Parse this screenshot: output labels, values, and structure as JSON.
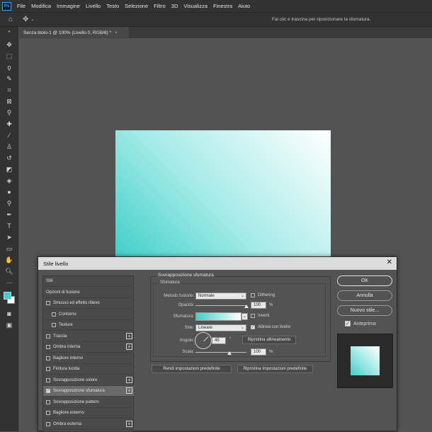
{
  "menubar": {
    "logo": "Ps",
    "items": [
      "File",
      "Modifica",
      "Immagine",
      "Livello",
      "Testo",
      "Selezione",
      "Filtro",
      "3D",
      "Visualizza",
      "Finestra",
      "Aiuto"
    ]
  },
  "optionsbar": {
    "hint": "Fai clic e trascina per riposizionare la sfumatura."
  },
  "document": {
    "tab_title": "Senza titolo-1 @ 100% (Livello 0, RGB/8) *",
    "close": "×"
  },
  "dialog": {
    "title": "Stile livello",
    "close": "✕",
    "styles": [
      {
        "label": "Stili",
        "checkbox": false,
        "plus": false,
        "indent": 0,
        "active": false,
        "checked": false
      },
      {
        "label": "Opzioni di fusione",
        "checkbox": false,
        "plus": false,
        "indent": 0,
        "active": false,
        "checked": false
      },
      {
        "label": "Smusso ed effetto rilievo",
        "checkbox": true,
        "plus": false,
        "indent": 0,
        "active": false,
        "checked": false
      },
      {
        "label": "Contorno",
        "checkbox": true,
        "plus": false,
        "indent": 1,
        "active": false,
        "checked": false
      },
      {
        "label": "Texture",
        "checkbox": true,
        "plus": false,
        "indent": 1,
        "active": false,
        "checked": false
      },
      {
        "label": "Traccia",
        "checkbox": true,
        "plus": true,
        "indent": 0,
        "active": false,
        "checked": false
      },
      {
        "label": "Ombra interna",
        "checkbox": true,
        "plus": true,
        "indent": 0,
        "active": false,
        "checked": false
      },
      {
        "label": "Bagliore interno",
        "checkbox": true,
        "plus": false,
        "indent": 0,
        "active": false,
        "checked": false
      },
      {
        "label": "Finitura lucida",
        "checkbox": true,
        "plus": false,
        "indent": 0,
        "active": false,
        "checked": false
      },
      {
        "label": "Sovrapposizione colore",
        "checkbox": true,
        "plus": true,
        "indent": 0,
        "active": false,
        "checked": false
      },
      {
        "label": "Sovrapposizione sfumatura",
        "checkbox": true,
        "plus": true,
        "indent": 0,
        "active": true,
        "checked": true
      },
      {
        "label": "Sovrapposizione pattern",
        "checkbox": true,
        "plus": false,
        "indent": 0,
        "active": false,
        "checked": false
      },
      {
        "label": "Bagliore esterno",
        "checkbox": true,
        "plus": false,
        "indent": 0,
        "active": false,
        "checked": false
      },
      {
        "label": "Ombra esterna",
        "checkbox": true,
        "plus": true,
        "indent": 0,
        "active": false,
        "checked": false
      }
    ],
    "section_title": "Sovrapposizione sfumatura",
    "subsection_title": "Sfumatura",
    "blend_mode_label": "Metodo fusione:",
    "blend_mode_value": "Normale",
    "dithering_label": "Dithering",
    "opacity_label": "Opacità:",
    "opacity_value": "100",
    "opacity_unit": "%",
    "gradient_label": "Sfumatura:",
    "invert_label": "Inverti",
    "style_label": "Stile:",
    "style_value": "Lineare",
    "align_label": "Allinea con livello",
    "angle_label": "Angolo:",
    "angle_value": "45",
    "angle_unit": "°",
    "reset_align_label": "Ripristina allineamento",
    "scale_label": "Scala:",
    "scale_value": "100",
    "scale_unit": "%",
    "make_default_label": "Rendi impostazioni predefinite",
    "reset_default_label": "Ripristina impostazioni predefinite",
    "ok_label": "OK",
    "cancel_label": "Annulla",
    "new_style_label": "Nuovo stile...",
    "preview_label": "Anteprima",
    "preview_checked": true,
    "align_checked": true,
    "opacity_fraction": 1.0,
    "scale_fraction": 0.67
  },
  "colors": {
    "accent_teal": "#3fcfc8",
    "foreground_swatch": "#3fcfc8",
    "background_swatch": "#ffffff"
  }
}
